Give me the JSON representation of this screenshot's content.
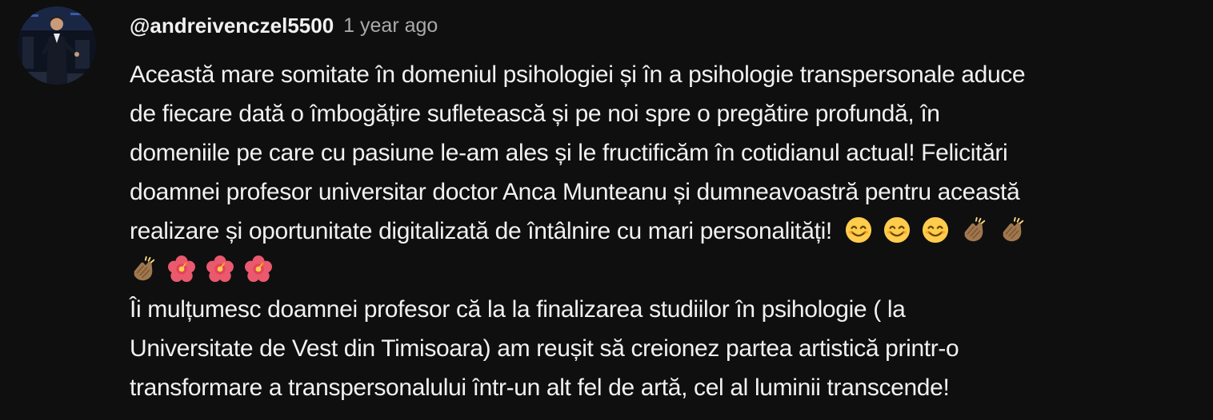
{
  "comment": {
    "author": "@andreivenczel5500",
    "timestamp": "1 year ago",
    "lines": [
      "Această mare somitate în domeniul psihologiei și în a  psihologie transpersonale aduce",
      "de fiecare dată o  îmbogățire sufletească și pe noi spre o pregătire profundă, în",
      "domeniile pe care cu pasiune le-am ales și le fructificăm în cotidianul actual! Felicitări",
      "doamnei profesor universitar doctor Anca Munteanu și dumneavoastră pentru această",
      "realizare și oportunitate digitalizată de întâlnire cu mari personalități!",
      "",
      "Îi mulțumesc doamnei profesor că la  la finalizarea studiilor în psihologie ( la",
      "Universitate de Vest din Timisoara) am reușit să creionez partea artistică printr-o",
      "transformare a transpersonalului într-un alt fel de artă, cel al luminii transcende!"
    ],
    "emojis": {
      "line5": [
        "smiling-face-emoji",
        "smiling-face-emoji",
        "smiling-face-emoji",
        "clapping-hands-emoji",
        "clapping-hands-emoji"
      ],
      "line6": [
        "clapping-hands-emoji",
        "hibiscus-emoji",
        "hibiscus-emoji",
        "hibiscus-emoji"
      ]
    }
  },
  "colors": {
    "background": "#0f0f0f",
    "text": "#f1f1f1",
    "timestamp": "#aaaaaa"
  }
}
